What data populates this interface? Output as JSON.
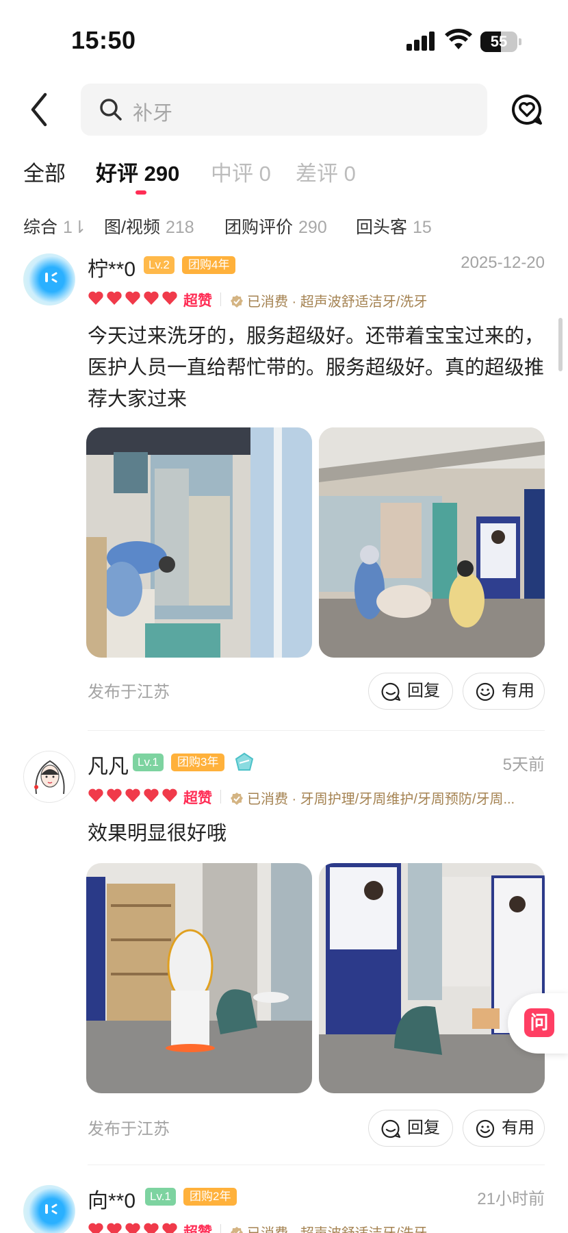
{
  "status_bar": {
    "time": "15:50",
    "battery": "55"
  },
  "search": {
    "placeholder": "补牙"
  },
  "tabs": [
    {
      "label": "全部"
    },
    {
      "label": "好评 290"
    },
    {
      "label": "中评 0"
    },
    {
      "label": "差评 0"
    }
  ],
  "filters": [
    {
      "label": "综合",
      "count": "1⇂"
    },
    {
      "label": "图/视频",
      "count": "218"
    },
    {
      "label": "团购评价",
      "count": "290"
    },
    {
      "label": "回头客",
      "count": "15"
    }
  ],
  "reviews": [
    {
      "user": "柠**0",
      "level": "Lv.2",
      "group_years": "团购4年",
      "date": "2025-12-20",
      "rating_label": "超赞",
      "consumed": "已消费 · 超声波舒适洁牙/洗牙",
      "content": "今天过来洗牙的，服务超级好。还带着宝宝过来的，医护人员一直给帮忙带的。服务超级好。真的超级推荐大家过来",
      "location": "发布于江苏",
      "reply_label": "回复",
      "useful_label": "有用"
    },
    {
      "user": "凡凡",
      "level": "Lv.1",
      "group_years": "团购3年",
      "date": "5天前",
      "rating_label": "超赞",
      "consumed": "已消费 · 牙周护理/牙周维护/牙周预防/牙周...",
      "content": "效果明显很好哦",
      "location": "发布于江苏",
      "reply_label": "回复",
      "useful_label": "有用"
    },
    {
      "user": "向**0",
      "level": "Lv.1",
      "group_years": "团购2年",
      "date": "21小时前",
      "rating_label": "超赞",
      "consumed": "已消费 · 超声波舒适洁牙/洗牙"
    }
  ],
  "ask_button": {
    "label": "问"
  },
  "colors": {
    "accent": "#ff2d55",
    "consumed_text": "#a48251",
    "muted": "#a3a3a3"
  },
  "icons": [
    "back-arrow-icon",
    "search-icon",
    "favorite-heart-bubble-icon",
    "heart-rating-icon",
    "verified-icon",
    "reply-icon",
    "smile-icon"
  ]
}
